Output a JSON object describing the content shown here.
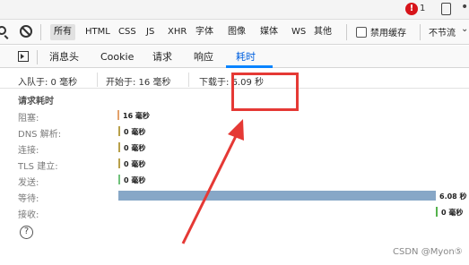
{
  "top": {
    "error_count": "1"
  },
  "filter_bar": {
    "tabs": [
      "所有",
      "HTML",
      "CSS",
      "JS",
      "XHR",
      "字体",
      "图像",
      "媒体",
      "WS",
      "其他"
    ],
    "selected": "所有",
    "persist_label": "禁用缓存",
    "throttle_label": "不节流"
  },
  "detail_tabs": {
    "tabs": [
      "消息头",
      "Cookie",
      "请求",
      "响应",
      "耗时"
    ],
    "active": "耗时"
  },
  "summary": {
    "queued": "入队于: 0 毫秒",
    "started": "开始于: 16 毫秒",
    "downloaded": "下载于: 6.09 秒"
  },
  "timings": {
    "title": "请求耗时",
    "rows": [
      {
        "label": "阻塞:",
        "value": "16 毫秒",
        "color": "#e3a16b",
        "fraction": 0.0026
      },
      {
        "label": "DNS 解析:",
        "value": "0 毫秒",
        "color": "#b8a04a",
        "fraction": 0
      },
      {
        "label": "连接:",
        "value": "0 毫秒",
        "color": "#b8a04a",
        "fraction": 0
      },
      {
        "label": "TLS 建立:",
        "value": "0 毫秒",
        "color": "#b8a04a",
        "fraction": 0
      },
      {
        "label": "发送:",
        "value": "0 毫秒",
        "color": "#70c17b",
        "fraction": 0
      },
      {
        "label": "等待:",
        "value": "6.08 秒",
        "color": "#87a7c7",
        "fraction": 0.998
      },
      {
        "label": "接收:",
        "value": "0 毫秒",
        "color": "#55b24d",
        "fraction": 0
      }
    ]
  },
  "watermark": "CSDN @Myon⑤",
  "annotation_color": "#e53935"
}
